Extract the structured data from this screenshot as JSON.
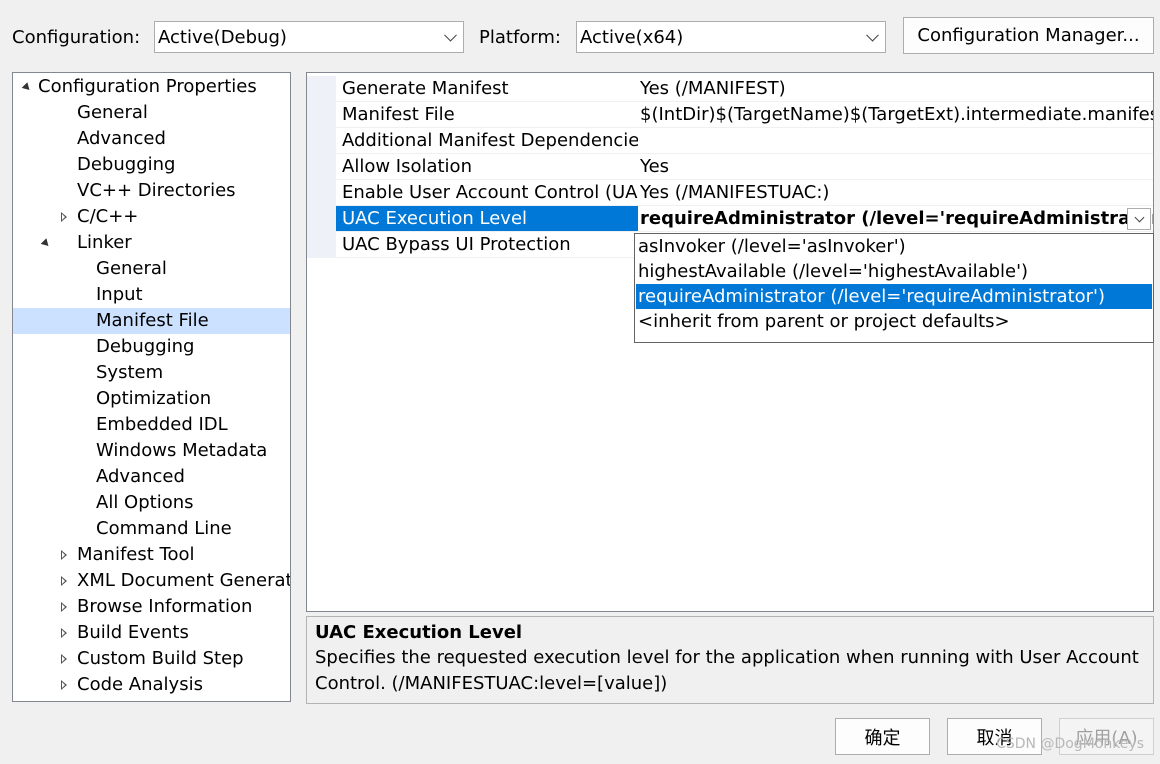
{
  "config": {
    "configuration_label": "Configuration:",
    "configuration_value": "Active(Debug)",
    "platform_label": "Platform:",
    "platform_value": "Active(x64)",
    "manager_button": "Configuration Manager..."
  },
  "tree": [
    {
      "label": "Configuration Properties",
      "level": 0,
      "expander": "open"
    },
    {
      "label": "General",
      "level": 1,
      "expander": "none"
    },
    {
      "label": "Advanced",
      "level": 1,
      "expander": "none"
    },
    {
      "label": "Debugging",
      "level": 1,
      "expander": "none"
    },
    {
      "label": "VC++ Directories",
      "level": 1,
      "expander": "none"
    },
    {
      "label": "C/C++",
      "level": 1,
      "expander": "closed"
    },
    {
      "label": "Linker",
      "level": 1,
      "expander": "open"
    },
    {
      "label": "General",
      "level": 2,
      "expander": "none"
    },
    {
      "label": "Input",
      "level": 2,
      "expander": "none"
    },
    {
      "label": "Manifest File",
      "level": 2,
      "expander": "none",
      "selected": true
    },
    {
      "label": "Debugging",
      "level": 2,
      "expander": "none"
    },
    {
      "label": "System",
      "level": 2,
      "expander": "none"
    },
    {
      "label": "Optimization",
      "level": 2,
      "expander": "none"
    },
    {
      "label": "Embedded IDL",
      "level": 2,
      "expander": "none"
    },
    {
      "label": "Windows Metadata",
      "level": 2,
      "expander": "none"
    },
    {
      "label": "Advanced",
      "level": 2,
      "expander": "none"
    },
    {
      "label": "All Options",
      "level": 2,
      "expander": "none"
    },
    {
      "label": "Command Line",
      "level": 2,
      "expander": "none"
    },
    {
      "label": "Manifest Tool",
      "level": 1,
      "expander": "closed"
    },
    {
      "label": "XML Document Generator",
      "level": 1,
      "expander": "closed"
    },
    {
      "label": "Browse Information",
      "level": 1,
      "expander": "closed"
    },
    {
      "label": "Build Events",
      "level": 1,
      "expander": "closed"
    },
    {
      "label": "Custom Build Step",
      "level": 1,
      "expander": "closed"
    },
    {
      "label": "Code Analysis",
      "level": 1,
      "expander": "closed"
    }
  ],
  "properties": [
    {
      "name": "Generate Manifest",
      "value": "Yes (/MANIFEST)"
    },
    {
      "name": "Manifest File",
      "value": "$(IntDir)$(TargetName)$(TargetExt).intermediate.manifest"
    },
    {
      "name": "Additional Manifest Dependencies",
      "value": ""
    },
    {
      "name": "Allow Isolation",
      "value": "Yes"
    },
    {
      "name": "Enable User Account Control (UAC)",
      "value": "Yes (/MANIFESTUAC:)"
    },
    {
      "name": "UAC Execution Level",
      "value": "requireAdministrator (/level='requireAdministrator')",
      "selected": true
    },
    {
      "name": "UAC Bypass UI Protection",
      "value": ""
    }
  ],
  "dropdown_options": [
    {
      "label": "asInvoker (/level='asInvoker')"
    },
    {
      "label": "highestAvailable (/level='highestAvailable')"
    },
    {
      "label": "requireAdministrator (/level='requireAdministrator')",
      "selected": true
    },
    {
      "label": "<inherit from parent or project defaults>"
    }
  ],
  "description": {
    "title": "UAC Execution Level",
    "text": "Specifies the requested execution level for the application when running with User Account Control.  (/MANIFESTUAC:level=[value])"
  },
  "buttons": {
    "ok": "确定",
    "cancel": "取消",
    "apply": "应用(A)"
  },
  "watermark": "CSDN @DogMonkeys",
  "colors": {
    "selection_blue": "#0078d7",
    "tree_selection": "#cce0ff"
  }
}
